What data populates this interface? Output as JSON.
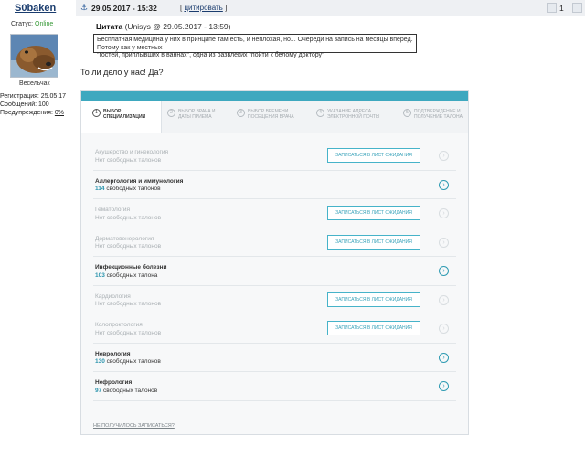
{
  "user": {
    "username": "S0baken",
    "status_label": "Статус:",
    "status_value": "Online",
    "rank": "Весельчак",
    "registration": "Регистрация: 25.05.17",
    "posts": "Сообщений: 100",
    "warnings_label": "Предупреждения:",
    "warnings_value": "0%"
  },
  "post": {
    "date": "29.05.2017 - 15:32",
    "quote_open": "[",
    "quote_link": "цитировать",
    "quote_close": "]",
    "number": "1",
    "quote_title_bold": "Цитата",
    "quote_title_rest": "(Unisys @ 29.05.2017 - 13:59)",
    "quote_line1": "Бесплатная медицина у них в принципе там есть, и неплохая, но... Очереди на запись на месяцы вперёд. Потому как у местных",
    "quote_line2": "\"гостей, приплывших в ваннах\", одна из развлеких \"пойти к белому доктору\"",
    "text": "То ли дело у нас! Да?"
  },
  "booking": {
    "accent_color": "#3ea8bf",
    "steps": [
      {
        "num": "1",
        "line1": "ВЫБОР",
        "line2": "СПЕЦИАЛИЗАЦИИ"
      },
      {
        "num": "2",
        "line1": "ВЫБОР ВРАЧА И",
        "line2": "ДАТЫ ПРИЕМА"
      },
      {
        "num": "3",
        "line1": "ВЫБОР ВРЕМЕНИ",
        "line2": "ПОСЕЩЕНИЯ ВРАЧА"
      },
      {
        "num": "4",
        "line1": "УКАЗАНИЕ АДРЕСА",
        "line2": "ЭЛЕКТРОННОЙ ПОЧТЫ"
      },
      {
        "num": "5",
        "line1": "ПОДТВЕРЖДЕНИЕ И",
        "line2": "ПОЛУЧЕНИЕ ТАЛОНА"
      }
    ],
    "wait_button": "ЗАПИСАТЬСЯ В ЛИСТ ОЖИДАНИЯ",
    "rows": [
      {
        "name": "Акушерство и гинекология",
        "count": "",
        "tickets": "Нет свободных талонов"
      },
      {
        "name": "Аллергология и иммунология",
        "count": "114",
        "tickets": "свободных талонов"
      },
      {
        "name": "Гематология",
        "count": "",
        "tickets": "Нет свободных талонов"
      },
      {
        "name": "Дерматовенерология",
        "count": "",
        "tickets": "Нет свободных талонов"
      },
      {
        "name": "Инфекционные болезни",
        "count": "103",
        "tickets": "свободных талона"
      },
      {
        "name": "Кардиология",
        "count": "",
        "tickets": "Нет свободных талонов"
      },
      {
        "name": "Колопроктология",
        "count": "",
        "tickets": "Нет свободных талонов"
      },
      {
        "name": "Неврология",
        "count": "130",
        "tickets": "свободных талонов"
      },
      {
        "name": "Нефрология",
        "count": "97",
        "tickets": "свободных талонов"
      }
    ],
    "footer": "НЕ ПОЛУЧИЛОСЬ ЗАПИСАТЬСЯ?"
  }
}
